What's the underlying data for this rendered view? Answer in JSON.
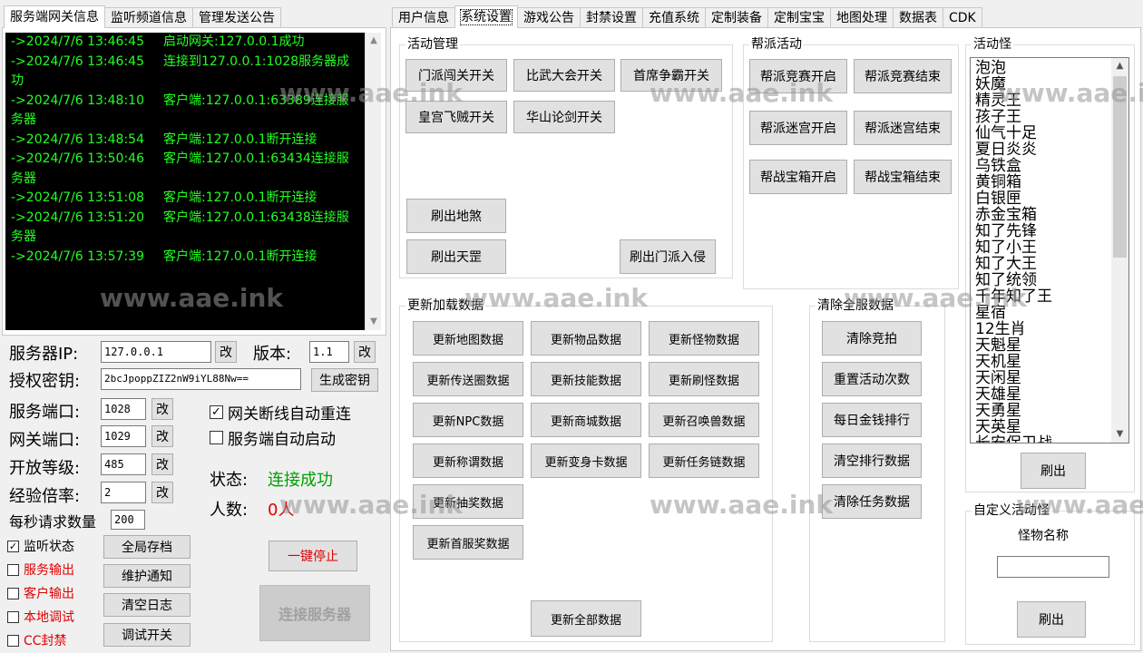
{
  "left_tabs": [
    "服务端网关信息",
    "监听频道信息",
    "管理发送公告"
  ],
  "right_tabs": [
    "用户信息",
    "系统设置",
    "游戏公告",
    "封禁设置",
    "充值系统",
    "定制装备",
    "定制宝宝",
    "地图处理",
    "数据表",
    "CDK"
  ],
  "log": [
    {
      "time": "->2024/7/6 13:46:45",
      "msg": "启动网关:127.0.0.1成功",
      "cont": ""
    },
    {
      "time": "->2024/7/6 13:46:45",
      "msg": "连接到127.0.0.1:1028服务器成",
      "cont": "功"
    },
    {
      "time": "->2024/7/6 13:48:10",
      "msg": "客户端:127.0.0.1:63389连接服",
      "cont": "务器"
    },
    {
      "time": "->2024/7/6 13:48:54",
      "msg": "客户端:127.0.0.1断开连接",
      "cont": ""
    },
    {
      "time": "->2024/7/6 13:50:46",
      "msg": "客户端:127.0.0.1:63434连接服",
      "cont": "务器"
    },
    {
      "time": "->2024/7/6 13:51:08",
      "msg": "客户端:127.0.0.1断开连接",
      "cont": ""
    },
    {
      "time": "->2024/7/6 13:51:20",
      "msg": "客户端:127.0.0.1:63438连接服",
      "cont": "务器"
    },
    {
      "time": "->2024/7/6 13:57:39",
      "msg": "客户端:127.0.0.1断开连接",
      "cont": ""
    }
  ],
  "server": {
    "ip_label": "服务器IP:",
    "ip_value": "127.0.0.1",
    "change": "改",
    "version_label": "版本:",
    "version_value": "1.1",
    "key_label": "授权密钥:",
    "key_value": "2bcJpoppZIZ2nW9iYL88Nw==",
    "gen_key": "生成密钥",
    "service_port_label": "服务端口:",
    "service_port": "1028",
    "gateway_port_label": "网关端口:",
    "gateway_port": "1029",
    "open_level_label": "开放等级:",
    "open_level": "485",
    "exp_rate_label": "经验倍率:",
    "exp_rate": "2",
    "rps_label": "每秒请求数量",
    "rps": "200",
    "auto_reconnect": "网关断线自动重连",
    "auto_start": "服务端自动启动",
    "status_label": "状态:",
    "status_value": "连接成功",
    "count_label": "人数:",
    "count_value": "0人"
  },
  "checks": [
    "监听状态",
    "服务输出",
    "客户输出",
    "本地调试",
    "CC封禁"
  ],
  "buttons_left": [
    "全局存档",
    "维护通知",
    "清空日志",
    "调试开关"
  ],
  "stop_all": "一键停止",
  "connect_server": "连接服务器",
  "activity": {
    "title": "活动管理",
    "buttons": [
      "门派闯关开关",
      "比武大会开关",
      "首席争霸开关",
      "皇宫飞贼开关",
      "华山论剑开关",
      "刷出地煞",
      "刷出天罡",
      "刷出门派入侵"
    ]
  },
  "guild": {
    "title": "帮派活动",
    "buttons": [
      "帮派竞赛开启",
      "帮派竞赛结束",
      "帮派迷宫开启",
      "帮派迷宫结束",
      "帮战宝箱开启",
      "帮战宝箱结束"
    ]
  },
  "reload": {
    "title": "更新加载数据",
    "buttons": [
      "更新地图数据",
      "更新物品数据",
      "更新怪物数据",
      "更新传送圈数据",
      "更新技能数据",
      "更新刷怪数据",
      "更新NPC数据",
      "更新商城数据",
      "更新召唤兽数据",
      "更新称谓数据",
      "更新变身卡数据",
      "更新任务链数据",
      "更新抽奖数据",
      "更新首服奖数据"
    ],
    "all": "更新全部数据"
  },
  "clear": {
    "title": "清除全服数据",
    "buttons": [
      "清除竞拍",
      "重置活动次数",
      "每日金钱排行",
      "清空排行数据",
      "清除任务数据"
    ]
  },
  "monsters": {
    "title": "活动怪",
    "items": [
      "泡泡",
      "妖魔",
      "精灵王",
      "孩子王",
      "仙气十足",
      "夏日炎炎",
      "乌铁盒",
      "黄铜箱",
      "白银匣",
      "赤金宝箱",
      "知了先锋",
      "知了小王",
      "知了大王",
      "知了统领",
      "千年知了王",
      "星宿",
      "12生肖",
      "天魁星",
      "天机星",
      "天闲星",
      "天雄星",
      "天勇星",
      "天英星",
      "长安保卫战"
    ],
    "refresh": "刷出"
  },
  "custom": {
    "title": "自定义活动怪",
    "name_label": "怪物名称",
    "name_value": "",
    "refresh": "刷出"
  },
  "watermark": "www.aae.ink"
}
